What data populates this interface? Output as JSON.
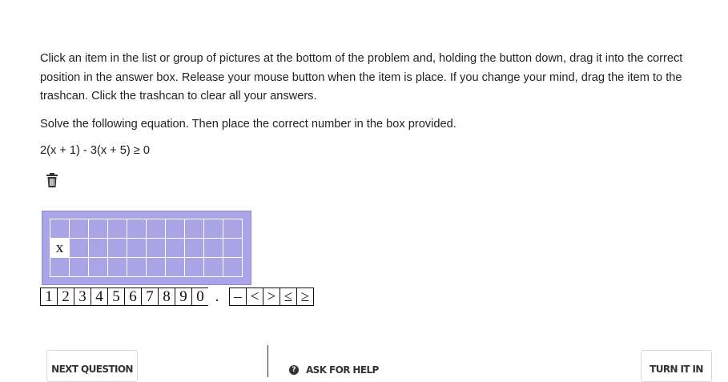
{
  "instructions": "Click an item in the list or group of pictures at the bottom of the problem and, holding the button down, drag it into the correct position in the answer box. Release your mouse button when the item is place. If you change your mind, drag the item to the trashcan. Click the trashcan to clear all your answers.",
  "prompt": "Solve the following equation. Then place the correct number in the box provided.",
  "equation": "2(x + 1) - 3(x + 5) ≥ 0",
  "trash_icon": "trash-icon",
  "answer_grid": {
    "rows": 3,
    "cols": 10,
    "cells": [
      [
        "",
        "",
        "",
        "",
        "",
        "",
        "",
        "",
        "",
        ""
      ],
      [
        "x",
        "",
        "",
        "",
        "",
        "",
        "",
        "",
        "",
        ""
      ],
      [
        "",
        "",
        "",
        "",
        "",
        "",
        "",
        "",
        "",
        ""
      ]
    ]
  },
  "tiles": [
    "1",
    "2",
    "3",
    "4",
    "5",
    "6",
    "7",
    "8",
    "9",
    "0",
    ".",
    "–",
    "<",
    ">",
    "≤",
    "≥"
  ],
  "footer": {
    "next_label": "NEXT QUESTION",
    "help_label": "ASK FOR HELP",
    "help_icon": "question-circle-icon",
    "turn_in_label": "TURN IT IN"
  },
  "colors": {
    "answer_box": "#a9a4e6",
    "text": "#222222"
  }
}
